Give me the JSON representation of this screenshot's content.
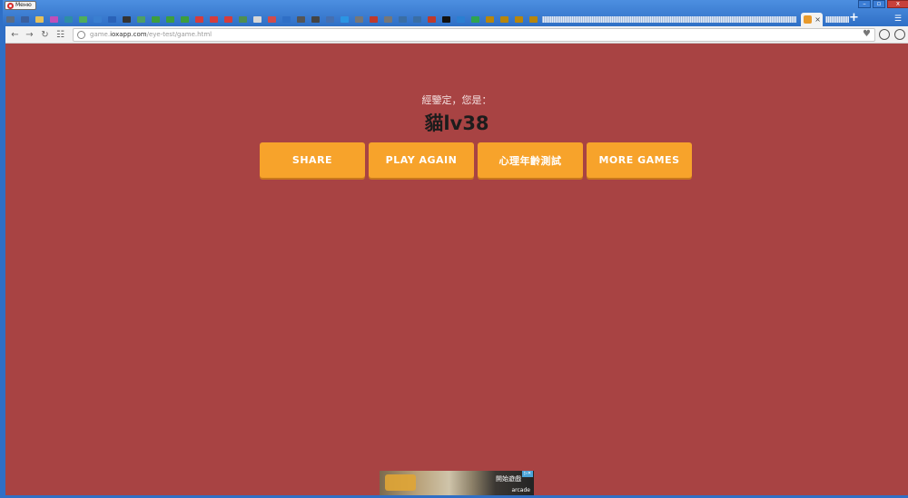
{
  "browser": {
    "menu_label": "Меню",
    "window_controls": {
      "minimize": "–",
      "maximize": "▫",
      "close": "x"
    },
    "active_tab_close": "×",
    "new_tab": "+",
    "address": {
      "domain_prefix": "game.",
      "domain": "ioxapp.com",
      "path": "/eye-test/game.html"
    }
  },
  "page": {
    "background_color": "#a84343",
    "result_label": "經鑒定，您是：",
    "result_title": "貓lv38",
    "buttons": [
      "SHARE",
      "PLAY AGAIN",
      "心理年齡測試",
      "MORE GAMES"
    ],
    "button_color": "#f7a32b",
    "ad": {
      "text": "開始遊戲",
      "brand": "arcade"
    }
  }
}
